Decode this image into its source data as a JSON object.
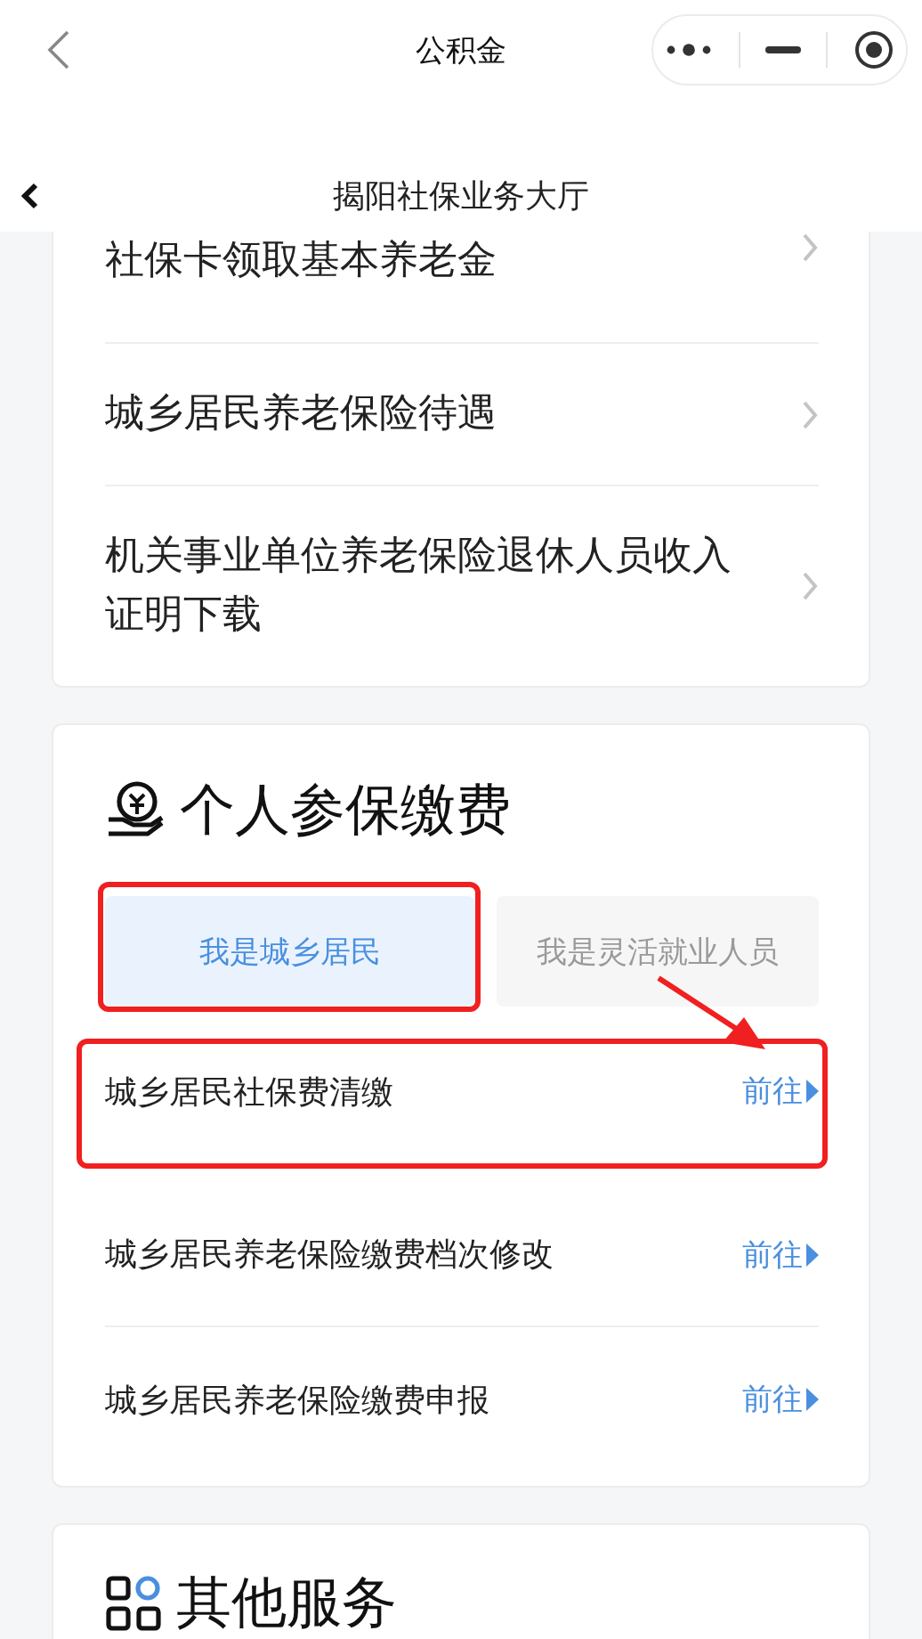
{
  "mini_program_title": "公积金",
  "page_title": "揭阳社保业务大厅",
  "service_list": [
    {
      "label": "社保卡领取基本养老金"
    },
    {
      "label": "城乡居民养老保险待遇"
    },
    {
      "label": "机关事业单位养老保险退休人员收入证明下载"
    }
  ],
  "contribution": {
    "title": "个人参保缴费",
    "tabs": [
      {
        "label": "我是城乡居民",
        "selected": true,
        "highlighted": true
      },
      {
        "label": "我是灵活就业人员",
        "selected": false,
        "highlighted": false
      }
    ],
    "items": [
      {
        "label": "城乡居民社保费清缴",
        "action": "前往",
        "highlighted": true
      },
      {
        "label": "城乡居民养老保险缴费档次修改",
        "action": "前往",
        "highlighted": false
      },
      {
        "label": "城乡居民养老保险缴费申报",
        "action": "前往",
        "highlighted": false
      }
    ]
  },
  "other_services": {
    "title": "其他服务"
  }
}
